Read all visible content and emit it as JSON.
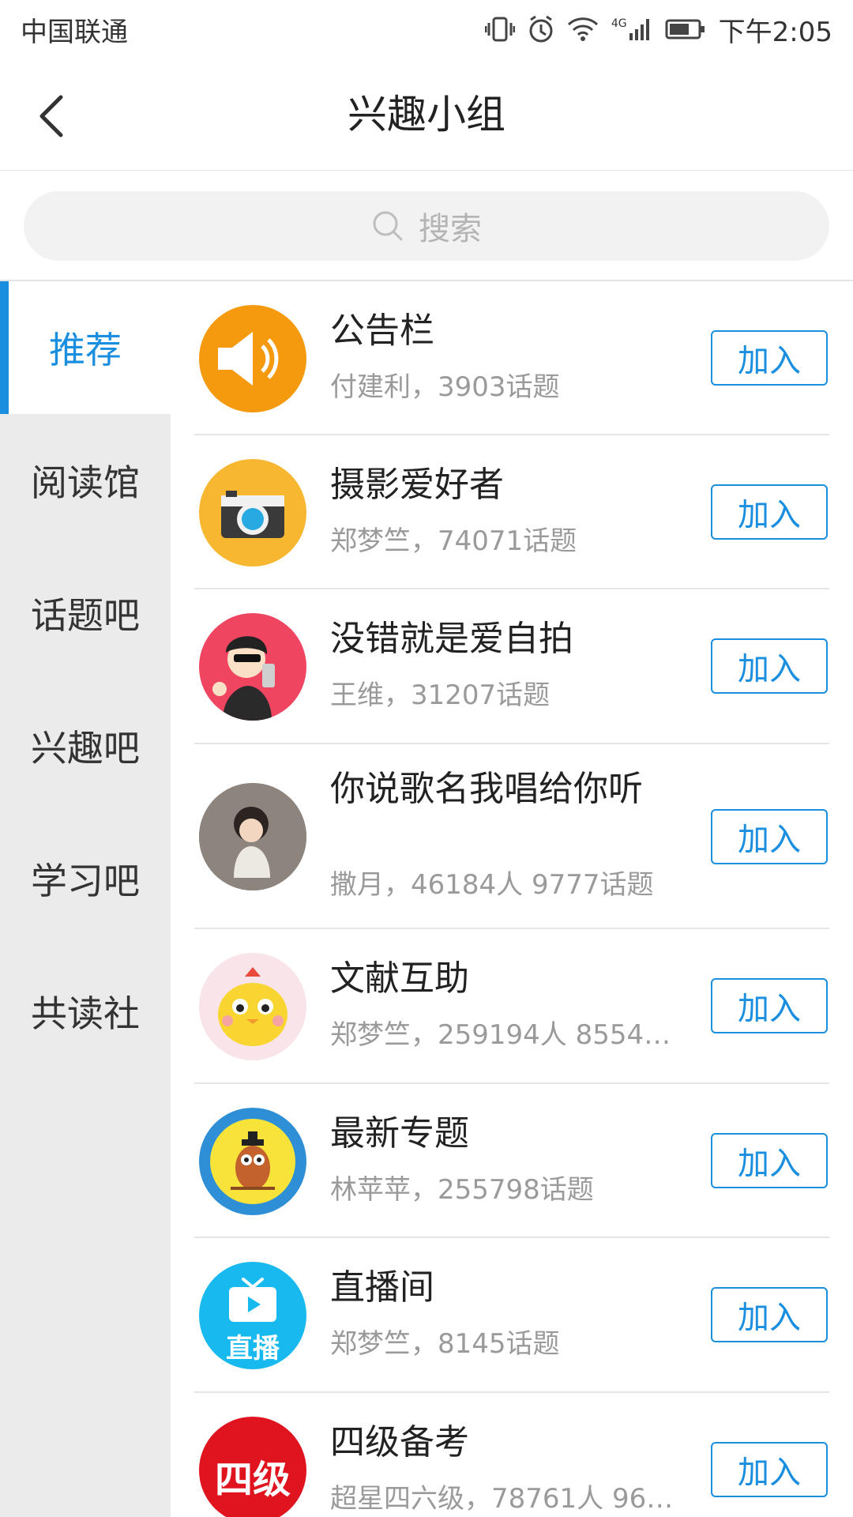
{
  "status_bar": {
    "carrier": "中国联通",
    "network": "4G",
    "time": "下午2:05"
  },
  "header": {
    "title": "兴趣小组"
  },
  "search": {
    "placeholder": "搜索"
  },
  "sidebar": {
    "items": [
      {
        "label": "推荐",
        "active": true
      },
      {
        "label": "阅读馆"
      },
      {
        "label": "话题吧"
      },
      {
        "label": "兴趣吧"
      },
      {
        "label": "学习吧"
      },
      {
        "label": "共读社"
      }
    ]
  },
  "groups": [
    {
      "name": "公告栏",
      "meta": "付建利，3903话题",
      "join": "加入",
      "icon": "speaker-icon"
    },
    {
      "name": "摄影爱好者",
      "meta": "郑梦竺，74071话题",
      "join": "加入",
      "icon": "camera-icon"
    },
    {
      "name": "没错就是爱自拍",
      "meta": "王维，31207话题",
      "join": "加入",
      "icon": "selfie-avatar"
    },
    {
      "name": "你说歌名我唱给你听",
      "meta": "撒月，46184人  9777话题",
      "join": "加入",
      "icon": "child-photo-avatar"
    },
    {
      "name": "文献互助",
      "meta": "郑梦竺，259194人  85540…",
      "join": "加入",
      "icon": "chick-avatar"
    },
    {
      "name": "最新专题",
      "meta": "林苹苹，255798话题",
      "join": "加入",
      "icon": "owl-avatar"
    },
    {
      "name": "直播间",
      "meta": "郑梦竺，8145话题",
      "join": "加入",
      "icon": "tv-icon",
      "icon_text": "直播"
    },
    {
      "name": "四级备考",
      "meta": "超星四六级，78761人  96…",
      "join": "加入",
      "icon": "cet4-icon",
      "icon_text": "四级"
    }
  ],
  "colors": {
    "accent": "#1a8fe0",
    "sidebar_bg": "#ebebeb",
    "meta_text": "#9a9a9a"
  }
}
